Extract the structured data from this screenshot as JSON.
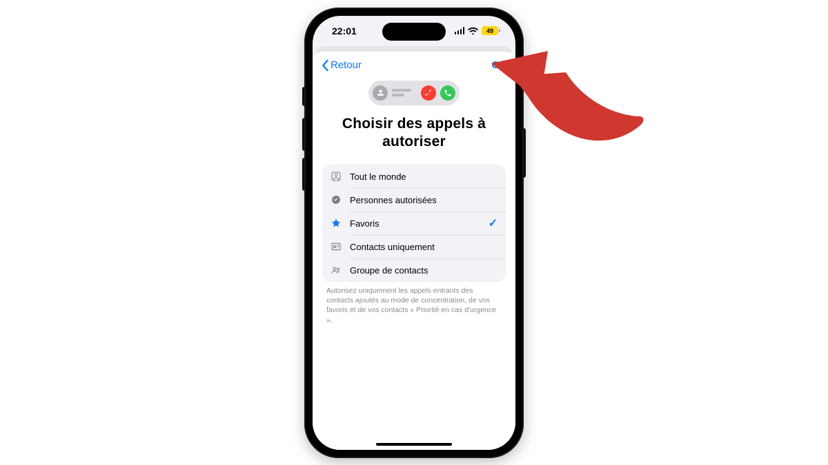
{
  "status": {
    "time": "22:01",
    "battery": "49"
  },
  "nav": {
    "back_label": "Retour",
    "done_label": "OK"
  },
  "page_title": "Choisir des appels à autoriser",
  "options": [
    {
      "icon": "globe-person-icon",
      "label": "Tout le monde",
      "selected": false
    },
    {
      "icon": "seal-check-icon",
      "label": "Personnes autorisées",
      "selected": false
    },
    {
      "icon": "star-icon",
      "label": "Favoris",
      "selected": true
    },
    {
      "icon": "contact-card-icon",
      "label": "Contacts uniquement",
      "selected": false
    },
    {
      "icon": "group-icon",
      "label": "Groupe de contacts",
      "selected": false
    }
  ],
  "footer_text": "Autorisez uniquement les appels entrants des contacts ajoutés au mode de concentration, de vos favoris et de vos contacts « Priorité en cas d'urgence ».",
  "colors": {
    "ios_blue": "#0a7aff",
    "arrow_red": "#d0372e",
    "battery_yellow": "#ffd60a"
  }
}
